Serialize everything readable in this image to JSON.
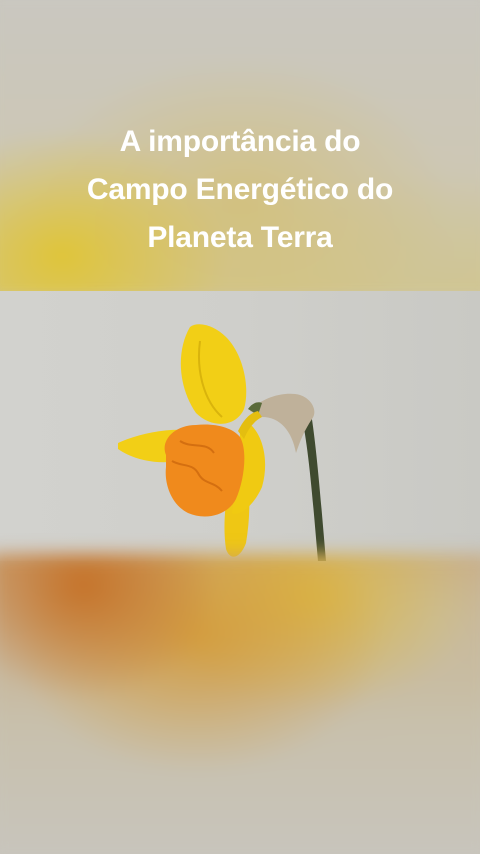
{
  "title": {
    "line1": "A importância do",
    "line2": "Campo Energético do",
    "line3": "Planeta Terra"
  },
  "colors": {
    "title_text": "#ffffff",
    "petal_yellow": "#f2cf16",
    "trumpet_orange": "#f08a1c",
    "stem": "#3f4a2f",
    "background_gray": "#d0d0cc"
  },
  "photo": {
    "subject": "daffodil-flower"
  }
}
